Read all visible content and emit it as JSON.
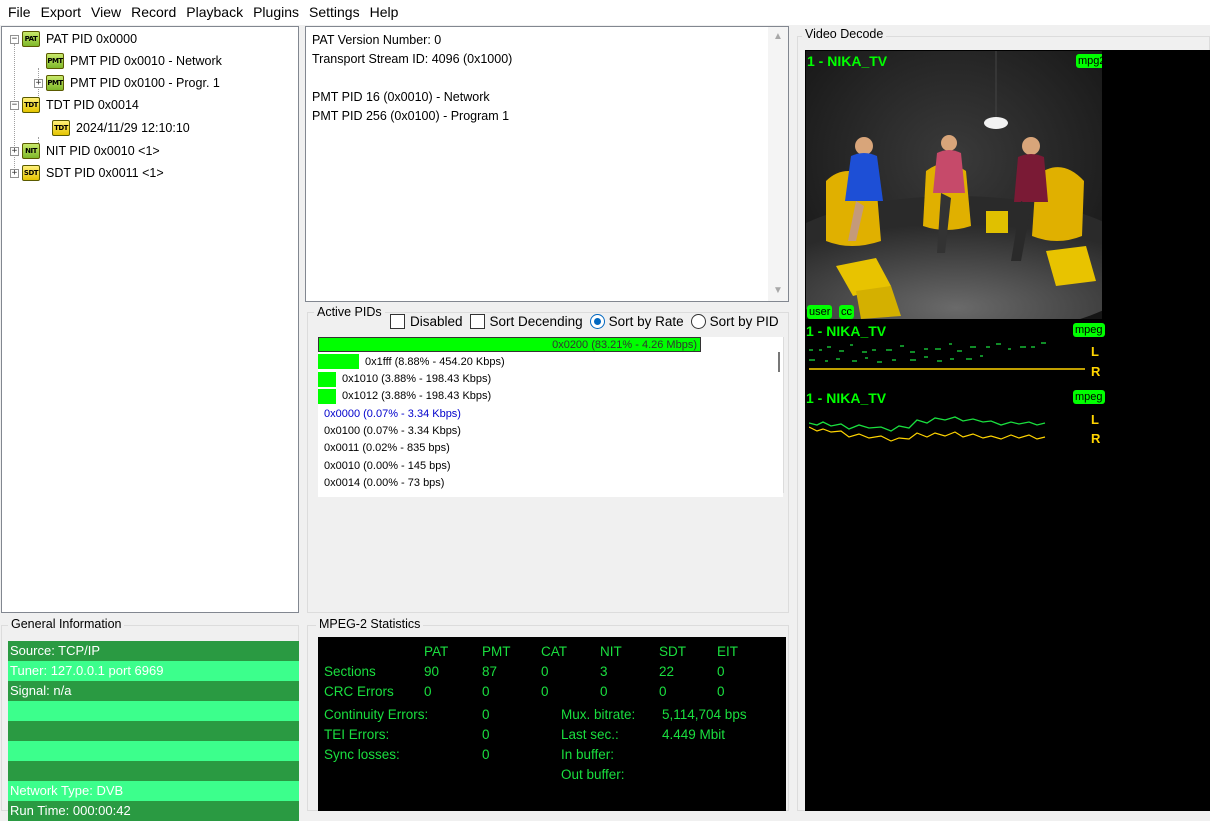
{
  "menu": [
    "File",
    "Export",
    "View",
    "Record",
    "Playback",
    "Plugins",
    "Settings",
    "Help"
  ],
  "tree": {
    "items": [
      {
        "label": "PAT PID 0x0000",
        "icon": "PAT",
        "expander": "−"
      },
      {
        "label": "PMT PID 0x0010 - Network",
        "icon": "PMT",
        "expander": ""
      },
      {
        "label": "PMT PID 0x0100 - Progr. 1",
        "icon": "PMT",
        "expander": "+"
      },
      {
        "label": "TDT PID 0x0014",
        "icon": "TDT",
        "expander": "−"
      },
      {
        "label": "2024/11/29 12:10:10",
        "icon": "TDT",
        "expander": ""
      },
      {
        "label": "NIT PID 0x0010 <1>",
        "icon": "NIT",
        "expander": "+"
      },
      {
        "label": "SDT PID 0x0011 <1>",
        "icon": "SDT",
        "expander": "+"
      }
    ]
  },
  "details": {
    "lines": [
      "PAT Version Number: 0",
      "Transport Stream ID: 4096 (0x1000)",
      "",
      "PMT PID 16 (0x0010) - Network",
      "PMT PID 256 (0x0100) - Program 1"
    ]
  },
  "active_pids": {
    "title": "Active PIDs",
    "options": {
      "disabled": {
        "label": "Disabled",
        "checked": false
      },
      "sort_descending": {
        "label": "Sort Decending",
        "checked": false
      },
      "sort_by_rate": {
        "label": "Sort by Rate",
        "selected": true
      },
      "sort_by_pid": {
        "label": "Sort by PID",
        "selected": false
      }
    },
    "rows": [
      {
        "text": "0x0200 (83.21% - 4.26 Mbps)",
        "percent": 83.21
      },
      {
        "text": "0x1fff (8.88% - 454.20 Kbps)",
        "percent": 8.88
      },
      {
        "text": "0x1010 (3.88% - 198.43 Kbps)",
        "percent": 3.88
      },
      {
        "text": "0x1012 (3.88% - 198.43 Kbps)",
        "percent": 3.88
      },
      {
        "text": "0x0000 (0.07% - 3.34 Kbps)",
        "percent": 0.07
      },
      {
        "text": "0x0100 (0.07% - 3.34 Kbps)",
        "percent": 0.07
      },
      {
        "text": "0x0011 (0.02% - 835 bps)",
        "percent": 0.02
      },
      {
        "text": "0x0010 (0.00% - 145 bps)",
        "percent": 0.0
      },
      {
        "text": "0x0014 (0.00% - 73 bps)",
        "percent": 0.0
      }
    ]
  },
  "general_info": {
    "title": "General Information",
    "rows": [
      "Source: TCP/IP",
      "Tuner: 127.0.0.1 port 6969",
      "Signal: n/a",
      "",
      "",
      "",
      "",
      "Network Type: DVB",
      "Run Time: 000:00:42"
    ]
  },
  "mpeg_stats": {
    "title": "MPEG-2 Statistics",
    "columns": [
      "PAT",
      "PMT",
      "CAT",
      "NIT",
      "SDT",
      "EIT"
    ],
    "sections_label": "Sections",
    "sections": [
      "90",
      "87",
      "0",
      "3",
      "22",
      "0"
    ],
    "crc_label": "CRC Errors",
    "crc": [
      "0",
      "0",
      "0",
      "0",
      "0",
      "0"
    ],
    "continuity_label": "Continuity Errors:",
    "continuity": "0",
    "tei_label": "TEI Errors:",
    "tei": "0",
    "sync_label": "Sync losses:",
    "sync": "0",
    "mux_label": "Mux. bitrate:",
    "mux": "5,114,704 bps",
    "last_label": "Last sec.:",
    "last": "4.449 Mbit",
    "in_buffer_label": "In buffer:",
    "out_buffer_label": "Out buffer:"
  },
  "video": {
    "title": "Video Decode",
    "channel": "1 - NIKA_TV",
    "video_codec": "mpg2",
    "audio_codec": "mpeg",
    "badges": [
      "user",
      "cc"
    ],
    "left": "L",
    "right": "R"
  },
  "colors": {
    "accent_green": "#00ff00",
    "info_dark": "#2a9a42",
    "info_light": "#3cff8c",
    "stats_text": "#1adf3f"
  }
}
